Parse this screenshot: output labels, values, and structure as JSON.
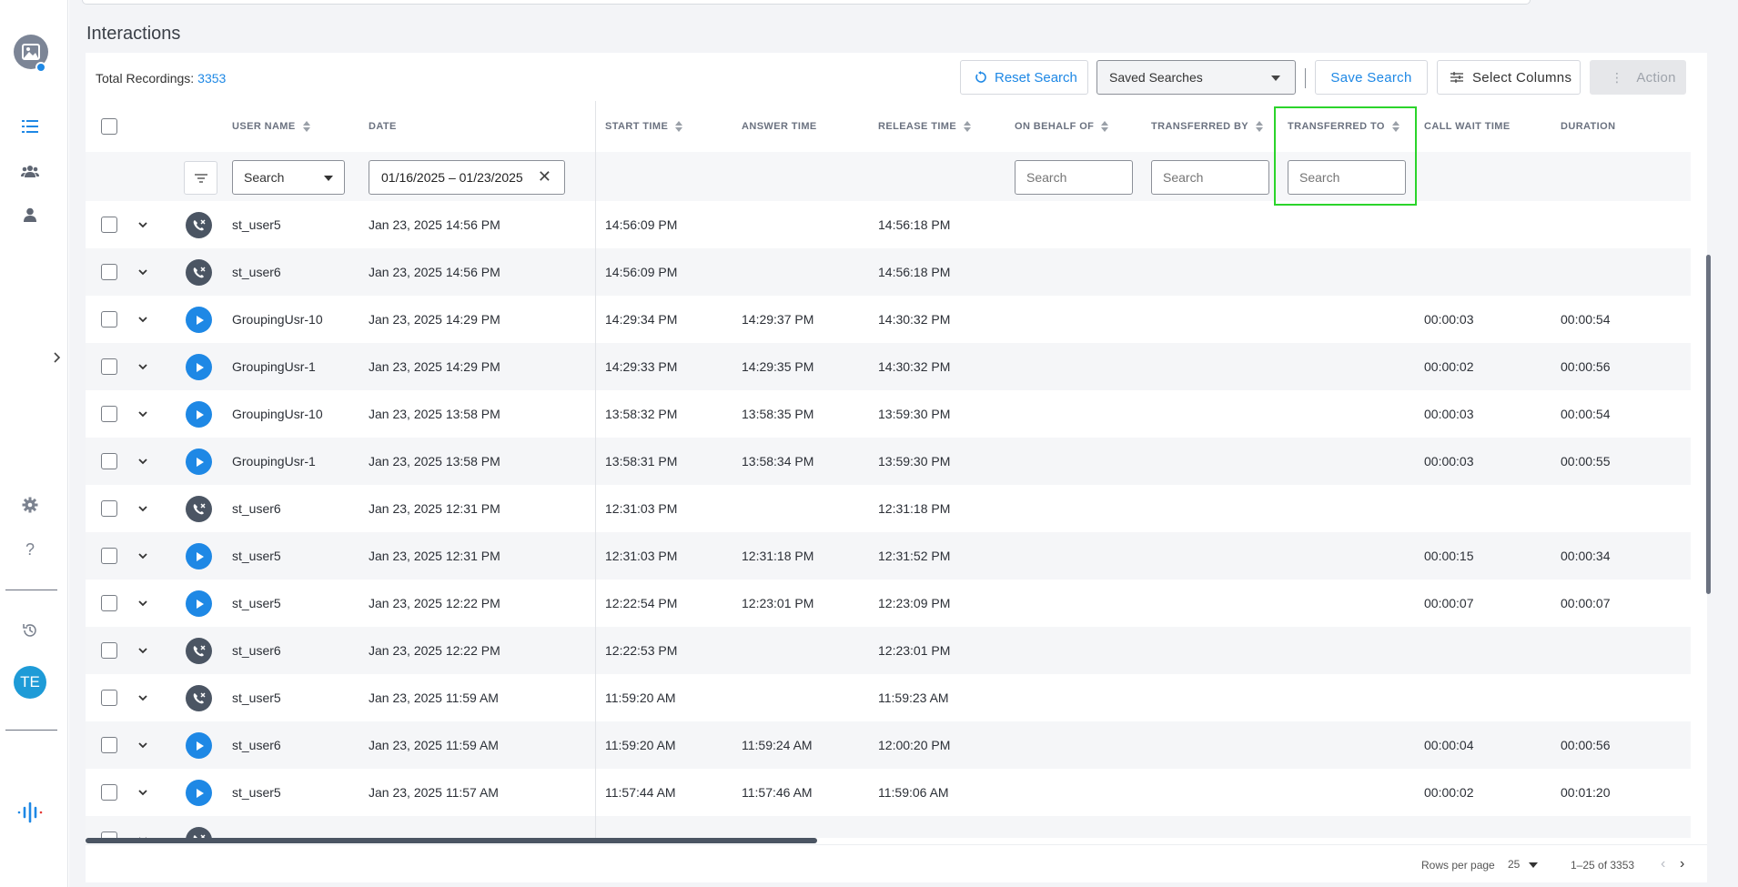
{
  "page": {
    "title": "Interactions"
  },
  "sidebar": {
    "user_initials": "TE"
  },
  "toolbar": {
    "total_label": "Total Recordings:",
    "total_count": "3353",
    "reset_label": "Reset Search",
    "saved_searches_label": "Saved Searches",
    "save_label": "Save Search",
    "columns_label": "Select Columns",
    "action_label": "Action"
  },
  "columns": {
    "user_name": "USER NAME",
    "date": "DATE",
    "start_time": "START TIME",
    "answer_time": "ANSWER TIME",
    "release_time": "RELEASE TIME",
    "on_behalf_of": "ON BEHALF OF",
    "transferred_by": "TRANSFERRED BY",
    "transferred_to": "TRANSFERRED TO",
    "call_wait_time": "CALL WAIT TIME",
    "duration": "DURATION"
  },
  "filters": {
    "user_select": "Search",
    "date_range": "01/16/2025 – 01/23/2025",
    "on_behalf_placeholder": "Search",
    "transferred_by_placeholder": "Search",
    "transferred_to_placeholder": "Search"
  },
  "rows": [
    {
      "type": "missed",
      "user": "st_user5",
      "date": "Jan 23, 2025 14:56 PM",
      "start": "14:56:09 PM",
      "answer": "",
      "release": "14:56:18 PM",
      "wait": "",
      "duration": ""
    },
    {
      "type": "missed",
      "user": "st_user6",
      "date": "Jan 23, 2025 14:56 PM",
      "start": "14:56:09 PM",
      "answer": "",
      "release": "14:56:18 PM",
      "wait": "",
      "duration": ""
    },
    {
      "type": "play",
      "user": "GroupingUsr-10",
      "date": "Jan 23, 2025 14:29 PM",
      "start": "14:29:34 PM",
      "answer": "14:29:37 PM",
      "release": "14:30:32 PM",
      "wait": "00:00:03",
      "duration": "00:00:54"
    },
    {
      "type": "play",
      "user": "GroupingUsr-1",
      "date": "Jan 23, 2025 14:29 PM",
      "start": "14:29:33 PM",
      "answer": "14:29:35 PM",
      "release": "14:30:32 PM",
      "wait": "00:00:02",
      "duration": "00:00:56"
    },
    {
      "type": "play",
      "user": "GroupingUsr-10",
      "date": "Jan 23, 2025 13:58 PM",
      "start": "13:58:32 PM",
      "answer": "13:58:35 PM",
      "release": "13:59:30 PM",
      "wait": "00:00:03",
      "duration": "00:00:54"
    },
    {
      "type": "play",
      "user": "GroupingUsr-1",
      "date": "Jan 23, 2025 13:58 PM",
      "start": "13:58:31 PM",
      "answer": "13:58:34 PM",
      "release": "13:59:30 PM",
      "wait": "00:00:03",
      "duration": "00:00:55"
    },
    {
      "type": "missed",
      "user": "st_user6",
      "date": "Jan 23, 2025 12:31 PM",
      "start": "12:31:03 PM",
      "answer": "",
      "release": "12:31:18 PM",
      "wait": "",
      "duration": ""
    },
    {
      "type": "play",
      "user": "st_user5",
      "date": "Jan 23, 2025 12:31 PM",
      "start": "12:31:03 PM",
      "answer": "12:31:18 PM",
      "release": "12:31:52 PM",
      "wait": "00:00:15",
      "duration": "00:00:34"
    },
    {
      "type": "play",
      "user": "st_user5",
      "date": "Jan 23, 2025 12:22 PM",
      "start": "12:22:54 PM",
      "answer": "12:23:01 PM",
      "release": "12:23:09 PM",
      "wait": "00:00:07",
      "duration": "00:00:07"
    },
    {
      "type": "missed",
      "user": "st_user6",
      "date": "Jan 23, 2025 12:22 PM",
      "start": "12:22:53 PM",
      "answer": "",
      "release": "12:23:01 PM",
      "wait": "",
      "duration": ""
    },
    {
      "type": "missed",
      "user": "st_user5",
      "date": "Jan 23, 2025 11:59 AM",
      "start": "11:59:20 AM",
      "answer": "",
      "release": "11:59:23 AM",
      "wait": "",
      "duration": ""
    },
    {
      "type": "play",
      "user": "st_user6",
      "date": "Jan 23, 2025 11:59 AM",
      "start": "11:59:20 AM",
      "answer": "11:59:24 AM",
      "release": "12:00:20 PM",
      "wait": "00:00:04",
      "duration": "00:00:56"
    },
    {
      "type": "play",
      "user": "st_user5",
      "date": "Jan 23, 2025 11:57 AM",
      "start": "11:57:44 AM",
      "answer": "11:57:46 AM",
      "release": "11:59:06 AM",
      "wait": "00:00:02",
      "duration": "00:01:20"
    },
    {
      "type": "missed",
      "user": "",
      "date": "",
      "start": "",
      "answer": "",
      "release": "",
      "wait": "",
      "duration": ""
    }
  ],
  "footer": {
    "rows_per_page_label": "Rows per page",
    "rows_per_page_value": "25",
    "range_label": "1–25 of 3353"
  }
}
